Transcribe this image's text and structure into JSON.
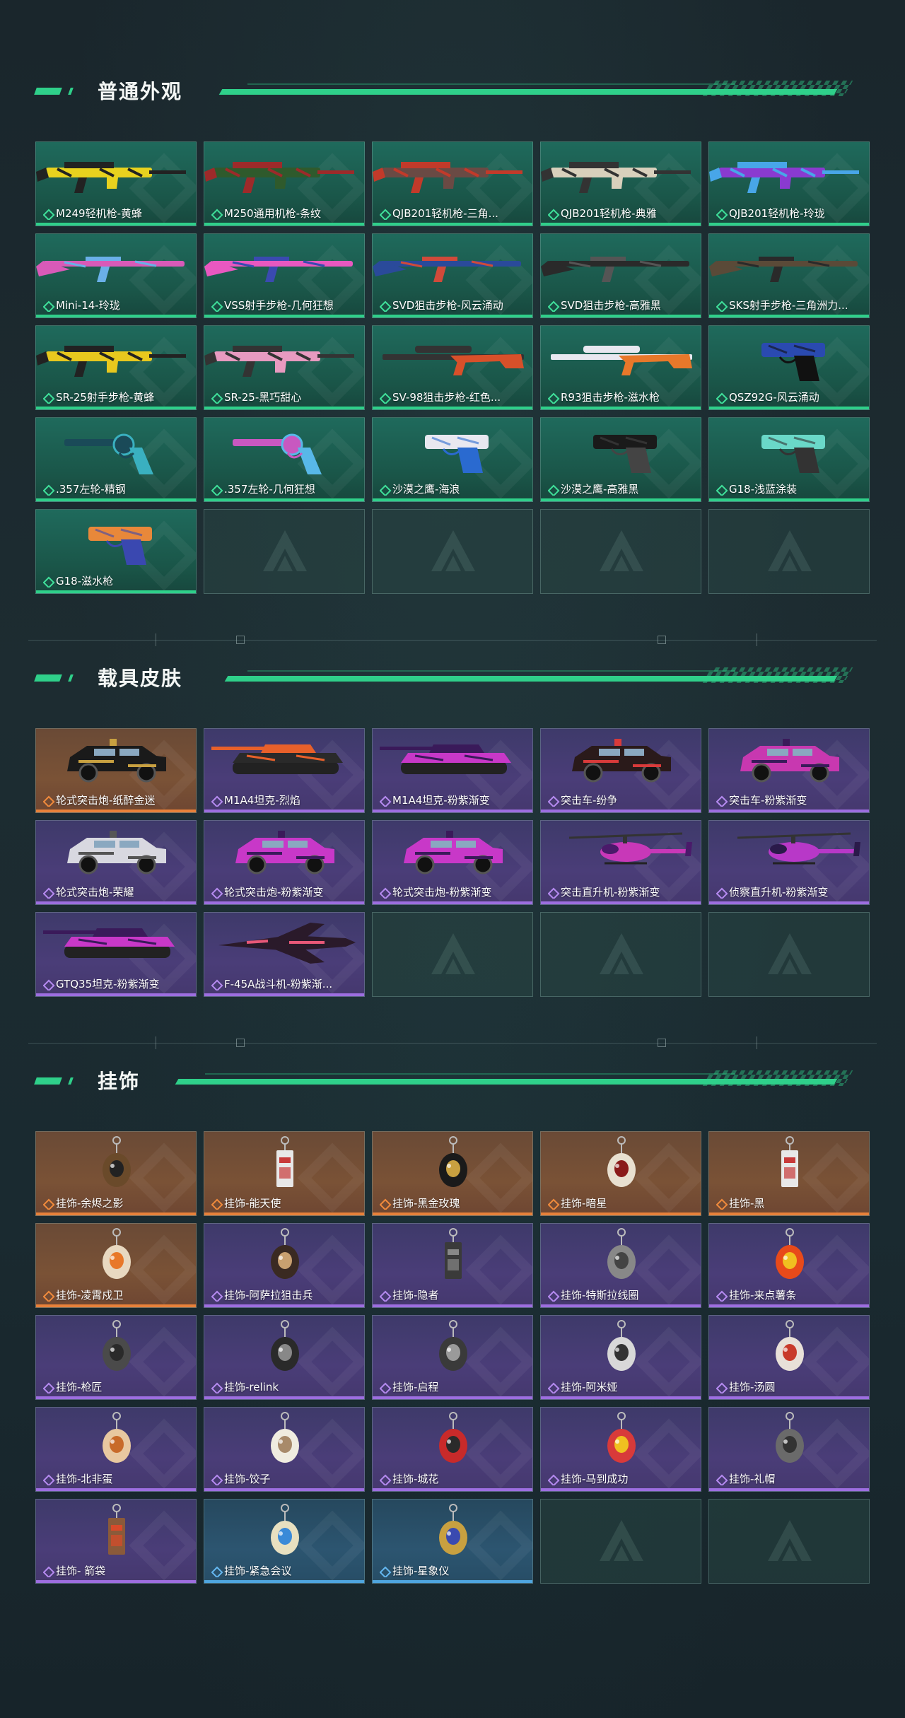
{
  "sections": [
    {
      "title": "普通外观",
      "items": [
        {
          "label": "M249轻机枪-黄蜂",
          "rarity": "green",
          "kind": "gun",
          "color": "#e8d21e",
          "accent": "#222"
        },
        {
          "label": "M250通用机枪-条纹",
          "rarity": "green",
          "kind": "gun",
          "color": "#2f5a2c",
          "accent": "#9d2a2a"
        },
        {
          "label": "QJB201轻机枪-三角...",
          "rarity": "green",
          "kind": "gun",
          "color": "#6a4a44",
          "accent": "#c23a2a"
        },
        {
          "label": "QJB201轻机枪-典雅",
          "rarity": "green",
          "kind": "gun",
          "color": "#d8d0bc",
          "accent": "#333"
        },
        {
          "label": "QJB201轻机枪-玲珑",
          "rarity": "green",
          "kind": "gun",
          "color": "#8a3ad0",
          "accent": "#48a6e8"
        },
        {
          "label": "Mini-14-玲珑",
          "rarity": "green",
          "kind": "rifle",
          "color": "#d85ab8",
          "accent": "#6ab0e8"
        },
        {
          "label": "VSS射手步枪-几何狂想",
          "rarity": "green",
          "kind": "rifle",
          "color": "#e858c0",
          "accent": "#3a4ab0"
        },
        {
          "label": "SVD狙击步枪-风云涌动",
          "rarity": "green",
          "kind": "rifle",
          "color": "#2a4a9a",
          "accent": "#d04a3a"
        },
        {
          "label": "SVD狙击步枪-高雅黑",
          "rarity": "green",
          "kind": "rifle",
          "color": "#2a2a2a",
          "accent": "#555"
        },
        {
          "label": "SKS射手步枪-三角洲力...",
          "rarity": "green",
          "kind": "rifle",
          "color": "#5a4a38",
          "accent": "#2a2a2a"
        },
        {
          "label": "SR-25射手步枪-黄蜂",
          "rarity": "green",
          "kind": "gun",
          "color": "#e8c81e",
          "accent": "#222"
        },
        {
          "label": "SR-25-黑巧甜心",
          "rarity": "green",
          "kind": "gun",
          "color": "#e89ac0",
          "accent": "#333"
        },
        {
          "label": "SV-98狙击步枪-红色...",
          "rarity": "green",
          "kind": "sniper",
          "color": "#d8502a",
          "accent": "#333"
        },
        {
          "label": "R93狙击步枪-滋水枪",
          "rarity": "green",
          "kind": "sniper",
          "color": "#e8782a",
          "accent": "#e8e8f0"
        },
        {
          "label": "QSZ92G-风云涌动",
          "rarity": "green",
          "kind": "pistol",
          "color": "#2a4ab0",
          "accent": "#111"
        },
        {
          "label": ".357左轮-精钢",
          "rarity": "green",
          "kind": "revolver",
          "color": "#1a4a58",
          "accent": "#3ab0c0"
        },
        {
          "label": ".357左轮-几何狂想",
          "rarity": "green",
          "kind": "revolver",
          "color": "#c858c0",
          "accent": "#58b8e8"
        },
        {
          "label": "沙漠之鹰-海浪",
          "rarity": "green",
          "kind": "pistol",
          "color": "#e8e8f0",
          "accent": "#2a6ad0"
        },
        {
          "label": "沙漠之鹰-高雅黑",
          "rarity": "green",
          "kind": "pistol",
          "color": "#1a1a1a",
          "accent": "#444"
        },
        {
          "label": "G18-浅蓝涂装",
          "rarity": "green",
          "kind": "pistol",
          "color": "#6ad8c8",
          "accent": "#333"
        },
        {
          "label": "G18-滋水枪",
          "rarity": "green",
          "kind": "pistol",
          "color": "#e8883a",
          "accent": "#3a48b0"
        },
        {
          "label": "",
          "rarity": "empty",
          "kind": "none"
        },
        {
          "label": "",
          "rarity": "empty",
          "kind": "none"
        },
        {
          "label": "",
          "rarity": "empty",
          "kind": "none"
        },
        {
          "label": "",
          "rarity": "empty",
          "kind": "none"
        }
      ]
    },
    {
      "title": "载具皮肤",
      "items": [
        {
          "label": "轮式突击炮-纸醉金迷",
          "rarity": "orange",
          "kind": "car",
          "color": "#1a1a1a",
          "accent": "#c8a040"
        },
        {
          "label": "M1A4坦克-烈焰",
          "rarity": "purple",
          "kind": "tank",
          "color": "#2a2a2a",
          "accent": "#e8602a"
        },
        {
          "label": "M1A4坦克-粉紫渐变",
          "rarity": "purple",
          "kind": "tank",
          "color": "#c838c8",
          "accent": "#3a1a5a"
        },
        {
          "label": "突击车-纷争",
          "rarity": "purple",
          "kind": "car",
          "color": "#2a1a1a",
          "accent": "#d83a3a"
        },
        {
          "label": "突击车-粉紫渐变",
          "rarity": "purple",
          "kind": "car",
          "color": "#c838b0",
          "accent": "#3a1a5a"
        },
        {
          "label": "轮式突击炮-荣耀",
          "rarity": "purple",
          "kind": "car",
          "color": "#d8d8e0",
          "accent": "#555"
        },
        {
          "label": "轮式突击炮-粉紫渐变",
          "rarity": "purple",
          "kind": "car",
          "color": "#c838c8",
          "accent": "#3a1a5a"
        },
        {
          "label": "轮式突击炮-粉紫渐变",
          "rarity": "purple",
          "kind": "car",
          "color": "#c838c8",
          "accent": "#3a1a5a"
        },
        {
          "label": "突击直升机-粉紫渐变",
          "rarity": "purple",
          "kind": "heli",
          "color": "#c838b8",
          "accent": "#4a1a6a"
        },
        {
          "label": "侦察直升机-粉紫渐变",
          "rarity": "purple",
          "kind": "heli",
          "color": "#b838c8",
          "accent": "#2a1a4a"
        },
        {
          "label": "GTQ35坦克-粉紫渐变",
          "rarity": "purple",
          "kind": "tank",
          "color": "#c838c8",
          "accent": "#3a1a5a"
        },
        {
          "label": "F-45A战斗机-粉紫渐...",
          "rarity": "purple",
          "kind": "jet",
          "color": "#2a1a2a",
          "accent": "#e85878"
        },
        {
          "label": "",
          "rarity": "empty",
          "kind": "none"
        },
        {
          "label": "",
          "rarity": "empty",
          "kind": "none"
        },
        {
          "label": "",
          "rarity": "empty",
          "kind": "none"
        }
      ]
    },
    {
      "title": "挂饰",
      "items": [
        {
          "label": "挂饰-余烬之影",
          "rarity": "orange",
          "kind": "charm",
          "color": "#6a4a2a",
          "accent": "#222"
        },
        {
          "label": "挂饰-能天使",
          "rarity": "orange",
          "kind": "tag",
          "color": "#e8e8e8",
          "accent": "#c83a3a"
        },
        {
          "label": "挂饰-黑金玫瑰",
          "rarity": "orange",
          "kind": "charm",
          "color": "#1a1a1a",
          "accent": "#c8a040"
        },
        {
          "label": "挂饰-暗星",
          "rarity": "orange",
          "kind": "charm",
          "color": "#e8e0d0",
          "accent": "#8a1a1a"
        },
        {
          "label": "挂饰-黑",
          "rarity": "orange",
          "kind": "tag",
          "color": "#e8e8e8",
          "accent": "#c83a3a"
        },
        {
          "label": "挂饰-凌霄戍卫",
          "rarity": "orange",
          "kind": "charm",
          "color": "#e8d8c0",
          "accent": "#e8782a"
        },
        {
          "label": "挂饰-阿萨拉狙击兵",
          "rarity": "purple",
          "kind": "charm",
          "color": "#3a2a22",
          "accent": "#c8a070"
        },
        {
          "label": "挂饰-隐者",
          "rarity": "purple",
          "kind": "tag",
          "color": "#3a3a3a",
          "accent": "#888"
        },
        {
          "label": "挂饰-特斯拉线圈",
          "rarity": "purple",
          "kind": "charm",
          "color": "#888",
          "accent": "#444"
        },
        {
          "label": "挂饰-来点薯条",
          "rarity": "purple",
          "kind": "charm",
          "color": "#e84a1a",
          "accent": "#f0c020"
        },
        {
          "label": "挂饰-枪匠",
          "rarity": "purple",
          "kind": "charm",
          "color": "#4a4a4a",
          "accent": "#2a2a2a"
        },
        {
          "label": "挂饰-relink",
          "rarity": "purple",
          "kind": "charm",
          "color": "#2a2a2a",
          "accent": "#888"
        },
        {
          "label": "挂饰-启程",
          "rarity": "purple",
          "kind": "charm",
          "color": "#3a3a3a",
          "accent": "#9a9a9a"
        },
        {
          "label": "挂饰-阿米娅",
          "rarity": "purple",
          "kind": "charm",
          "color": "#d8d8d8",
          "accent": "#333"
        },
        {
          "label": "挂饰-汤圆",
          "rarity": "purple",
          "kind": "charm",
          "color": "#e8e0d8",
          "accent": "#c83a2a"
        },
        {
          "label": "挂饰-北非蛋",
          "rarity": "purple",
          "kind": "charm",
          "color": "#e8c8a0",
          "accent": "#c86a2a"
        },
        {
          "label": "挂饰-饺子",
          "rarity": "purple",
          "kind": "charm",
          "color": "#f0ece0",
          "accent": "#a88a6a"
        },
        {
          "label": "挂饰-城花",
          "rarity": "purple",
          "kind": "charm",
          "color": "#c82a2a",
          "accent": "#2a2a2a"
        },
        {
          "label": "挂饰-马到成功",
          "rarity": "purple",
          "kind": "charm",
          "color": "#d83a3a",
          "accent": "#f0c020"
        },
        {
          "label": "挂饰-礼帽",
          "rarity": "purple",
          "kind": "charm",
          "color": "#6a6a6a",
          "accent": "#333"
        },
        {
          "label": "挂饰- 箭袋",
          "rarity": "purple",
          "kind": "tag",
          "color": "#8a5a3a",
          "accent": "#d84a2a"
        },
        {
          "label": "挂饰-紧急会议",
          "rarity": "blue",
          "kind": "charm",
          "color": "#e8e0c0",
          "accent": "#3a8ad8"
        },
        {
          "label": "挂饰-星象仪",
          "rarity": "blue",
          "kind": "charm",
          "color": "#c8a040",
          "accent": "#3a4ab0"
        },
        {
          "label": "",
          "rarity": "empty",
          "kind": "none"
        },
        {
          "label": "",
          "rarity": "empty",
          "kind": "none"
        }
      ]
    }
  ]
}
